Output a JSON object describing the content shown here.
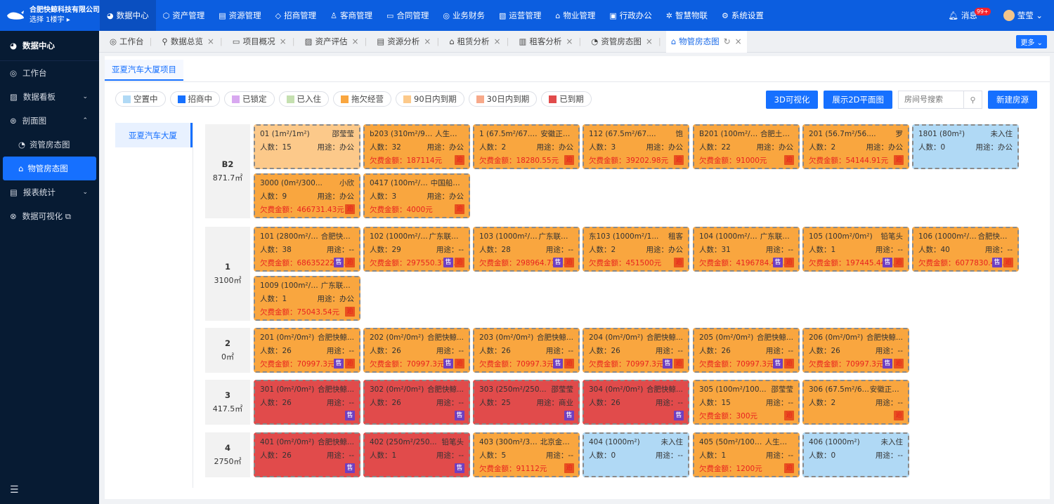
{
  "brand": {
    "company": "合肥快鲸科技有限公司",
    "location": "选择 1楼宇 ▸"
  },
  "topnav": [
    {
      "label": "数据中心",
      "icon": "◕",
      "active": true
    },
    {
      "label": "资产管理",
      "icon": "⬡"
    },
    {
      "label": "资源管理",
      "icon": "▤"
    },
    {
      "label": "招商管理",
      "icon": "◇"
    },
    {
      "label": "客商管理",
      "icon": "♙"
    },
    {
      "label": "合同管理",
      "icon": "▭"
    },
    {
      "label": "业务财务",
      "icon": "◎"
    },
    {
      "label": "运营管理",
      "icon": "▧"
    },
    {
      "label": "物业管理",
      "icon": "⌂"
    },
    {
      "label": "行政办公",
      "icon": "▣"
    },
    {
      "label": "智慧物联",
      "icon": "✲"
    },
    {
      "label": "系统设置",
      "icon": "⚙"
    }
  ],
  "topright": {
    "message_label": "消息",
    "message_badge": "99+",
    "user": "莹莹"
  },
  "sidebar": {
    "header": "数据中心",
    "items": [
      {
        "label": "工作台",
        "icon": "◎"
      },
      {
        "label": "数据看板",
        "icon": "▨",
        "chev": "⌄"
      },
      {
        "label": "剖面图",
        "icon": "⊛",
        "chev": "⌃"
      }
    ],
    "sub_items": [
      {
        "label": "资管房态图",
        "icon": "◔"
      },
      {
        "label": "物管房态图",
        "icon": "⌂",
        "active": true
      }
    ],
    "items2": [
      {
        "label": "报表统计",
        "icon": "▤",
        "chev": "⌄"
      },
      {
        "label": "数据可视化 ⧉",
        "icon": "⊗"
      }
    ],
    "footer_icon": "☰"
  },
  "tabs": [
    {
      "label": "工作台",
      "icon": "◎",
      "closable": false
    },
    {
      "label": "数据总览",
      "icon": "⚲"
    },
    {
      "label": "项目概况",
      "icon": "▭"
    },
    {
      "label": "资产评估",
      "icon": "▨"
    },
    {
      "label": "资源分析",
      "icon": "▤"
    },
    {
      "label": "租赁分析",
      "icon": "⌂"
    },
    {
      "label": "租客分析",
      "icon": "▥"
    },
    {
      "label": "资管房态图",
      "icon": "◔"
    },
    {
      "label": "物管房态图",
      "icon": "⌂",
      "active": true,
      "refresh": "↻"
    }
  ],
  "more_label": "更多 ⌄",
  "project_tab": "亚夏汽车大厦项目",
  "legend": [
    {
      "label": "空置中",
      "color": "#b0d9f5"
    },
    {
      "label": "招商中",
      "color": "#1670ff"
    },
    {
      "label": "已锁定",
      "color": "#d8a8f0"
    },
    {
      "label": "已入住",
      "color": "#c5e0b0"
    },
    {
      "label": "拖欠经营",
      "color": "#f9a63f"
    },
    {
      "label": "90日内到期",
      "color": "#fcc98a"
    },
    {
      "label": "30日内到期",
      "color": "#f7a98a"
    },
    {
      "label": "已到期",
      "color": "#e14b4b"
    }
  ],
  "actions": {
    "btn_3d": "3D可视化",
    "btn_2d": "展示2D平面图",
    "search_placeholder": "房间号搜索",
    "btn_new": "新建房源"
  },
  "building": "亚夏汽车大厦",
  "labels": {
    "people": "人数：",
    "usage": "用途：",
    "owe": "欠费金额：",
    "sell_tag": "售",
    "owe_tag": "逾"
  },
  "floors": [
    {
      "name": "B2",
      "area": "871.7㎡",
      "units": [
        {
          "title": "01 (1m²/1m²)",
          "tenant": "邵莹莹",
          "people": "15",
          "usage": "办公",
          "owe": "",
          "status": "light",
          "sell": false,
          "owe_tag": false
        },
        {
          "title": "b203 (310m²/99...",
          "tenant": "人生如梦",
          "people": "32",
          "usage": "办公",
          "owe": "187114元",
          "status": "overdue",
          "sell": false,
          "owe_tag": true
        },
        {
          "title": "1 (67.5m²/67.5m²)",
          "tenant": "安徽正豪...",
          "people": "2",
          "usage": "办公",
          "owe": "18280.55元",
          "status": "overdue",
          "sell": false,
          "owe_tag": true
        },
        {
          "title": "112 (67.5m²/67....",
          "tenant": "饱",
          "people": "3",
          "usage": "办公",
          "owe": "39202.98元",
          "status": "overdue",
          "sell": false,
          "owe_tag": true
        },
        {
          "title": "B201 (100m²/10...",
          "tenant": "合肥土土...",
          "people": "22",
          "usage": "办公",
          "owe": "91000元",
          "status": "overdue",
          "sell": false,
          "owe_tag": true
        },
        {
          "title": "201 (56.7m²/56....",
          "tenant": "罗",
          "people": "2",
          "usage": "办公",
          "owe": "54144.91元",
          "status": "overdue",
          "sell": false,
          "owe_tag": true
        },
        {
          "title": "1801 (80m²)",
          "tenant": "未入住",
          "people": "0",
          "usage": "办公",
          "owe": "",
          "status": "vacant",
          "sell": false,
          "owe_tag": false
        },
        {
          "title": "3000 (0m²/300...",
          "tenant": "小欣",
          "people": "9",
          "usage": "办公",
          "owe": "466731.43元",
          "status": "overdue",
          "sell": false,
          "owe_tag": true
        },
        {
          "title": "0417 (100m²/10...",
          "tenant": "中国船舶...",
          "people": "3",
          "usage": "办公",
          "owe": "4000元",
          "status": "overdue",
          "sell": false,
          "owe_tag": true
        }
      ]
    },
    {
      "name": "1",
      "area": "3100㎡",
      "units": [
        {
          "title": "101 (2800m²/20...",
          "tenant": "合肥快鲸...",
          "people": "38",
          "usage": "--",
          "owe": "686352226...",
          "status": "overdue",
          "sell": true,
          "owe_tag": true
        },
        {
          "title": "102 (1000m²/0...",
          "tenant": "广东联通...",
          "people": "29",
          "usage": "--",
          "owe": "297550.370...",
          "status": "overdue",
          "sell": true,
          "owe_tag": true
        },
        {
          "title": "103 (1000m²/0...",
          "tenant": "广东联通...",
          "people": "28",
          "usage": "--",
          "owe": "298964.710...",
          "status": "overdue",
          "sell": true,
          "owe_tag": true
        },
        {
          "title": "东103 (1000m²/1...",
          "tenant": "租客",
          "people": "2",
          "usage": "办公",
          "owe": "451500元",
          "status": "overdue",
          "sell": false,
          "owe_tag": true
        },
        {
          "title": "104 (1000m²/10...",
          "tenant": "广东联通...",
          "people": "31",
          "usage": "--",
          "owe": "4196784.45...",
          "status": "overdue",
          "sell": true,
          "owe_tag": true
        },
        {
          "title": "105 (100m²/0m²)",
          "tenant": "铅笔头",
          "people": "1",
          "usage": "--",
          "owe": "197445.440...",
          "status": "overdue",
          "sell": true,
          "owe_tag": true
        },
        {
          "title": "106 (1000m²/0...",
          "tenant": "合肥快鲸...",
          "people": "40",
          "usage": "--",
          "owe": "6077830.43...",
          "status": "overdue",
          "sell": true,
          "owe_tag": true
        },
        {
          "title": "1009 (100m²/10...",
          "tenant": "广东联通...",
          "people": "1",
          "usage": "办公",
          "owe": "75043.54元",
          "status": "overdue",
          "sell": false,
          "owe_tag": true
        }
      ]
    },
    {
      "name": "2",
      "area": "0㎡",
      "units": [
        {
          "title": "201 (0m²/0m²)",
          "tenant": "合肥快鲸...",
          "people": "26",
          "usage": "--",
          "owe": "70997.3元",
          "status": "overdue",
          "sell": true,
          "owe_tag": true
        },
        {
          "title": "202 (0m²/0m²)",
          "tenant": "合肥快鲸...",
          "people": "26",
          "usage": "--",
          "owe": "70997.3元",
          "status": "overdue",
          "sell": true,
          "owe_tag": true
        },
        {
          "title": "203 (0m²/0m²)",
          "tenant": "合肥快鲸...",
          "people": "26",
          "usage": "--",
          "owe": "70997.3元",
          "status": "overdue",
          "sell": true,
          "owe_tag": true
        },
        {
          "title": "204 (0m²/0m²)",
          "tenant": "合肥快鲸...",
          "people": "26",
          "usage": "--",
          "owe": "70997.3元",
          "status": "overdue",
          "sell": true,
          "owe_tag": true
        },
        {
          "title": "205 (0m²/0m²)",
          "tenant": "合肥快鲸...",
          "people": "26",
          "usage": "--",
          "owe": "70997.3元",
          "status": "overdue",
          "sell": true,
          "owe_tag": true
        },
        {
          "title": "206 (0m²/0m²)",
          "tenant": "合肥快鲸...",
          "people": "26",
          "usage": "--",
          "owe": "70997.3元",
          "status": "overdue",
          "sell": true,
          "owe_tag": true
        }
      ]
    },
    {
      "name": "3",
      "area": "417.5㎡",
      "units": [
        {
          "title": "301 (0m²/0m²)",
          "tenant": "合肥快鲸...",
          "people": "26",
          "usage": "--",
          "owe": "",
          "status": "expired",
          "sell": true,
          "owe_tag": false
        },
        {
          "title": "302 (0m²/0m²)",
          "tenant": "合肥快鲸...",
          "people": "26",
          "usage": "--",
          "owe": "",
          "status": "expired",
          "sell": true,
          "owe_tag": false
        },
        {
          "title": "303 (250m²/250...",
          "tenant": "邵莹莹",
          "people": "25",
          "usage": "商业",
          "owe": "",
          "status": "expired",
          "sell": true,
          "owe_tag": false
        },
        {
          "title": "304 (0m²/0m²)",
          "tenant": "合肥快鲸...",
          "people": "26",
          "usage": "--",
          "owe": "",
          "status": "expired",
          "sell": true,
          "owe_tag": false
        },
        {
          "title": "305 (100m²/100...",
          "tenant": "邵莹莹",
          "people": "15",
          "usage": "--",
          "owe": "300元",
          "status": "overdue",
          "sell": false,
          "owe_tag": true
        },
        {
          "title": "306 (67.5m²/67....",
          "tenant": "安徽正豪...",
          "people": "2",
          "usage": "--",
          "owe": "",
          "status": "overdue",
          "sell": false,
          "owe_tag": true
        }
      ]
    },
    {
      "name": "4",
      "area": "2750㎡",
      "units": [
        {
          "title": "401 (0m²/0m²)",
          "tenant": "合肥快鲸...",
          "people": "26",
          "usage": "--",
          "owe": "",
          "status": "expired",
          "sell": true,
          "owe_tag": false
        },
        {
          "title": "402 (250m²/250...",
          "tenant": "铅笔头",
          "people": "1",
          "usage": "--",
          "owe": "",
          "status": "expired",
          "sell": true,
          "owe_tag": false
        },
        {
          "title": "403 (300m²/300...",
          "tenant": "北京金都...",
          "people": "5",
          "usage": "--",
          "owe": "91112元",
          "status": "overdue",
          "sell": false,
          "owe_tag": true
        },
        {
          "title": "404 (1000m²)",
          "tenant": "未入住",
          "people": "0",
          "usage": "--",
          "owe": "",
          "status": "vacant",
          "sell": false,
          "owe_tag": false
        },
        {
          "title": "405 (50m²/100m²)",
          "tenant": "人生如梦",
          "people": "1",
          "usage": "--",
          "owe": "1200元",
          "status": "overdue",
          "sell": false,
          "owe_tag": true
        },
        {
          "title": "406 (1000m²)",
          "tenant": "未入住",
          "people": "0",
          "usage": "--",
          "owe": "",
          "status": "vacant",
          "sell": false,
          "owe_tag": false
        }
      ]
    }
  ]
}
